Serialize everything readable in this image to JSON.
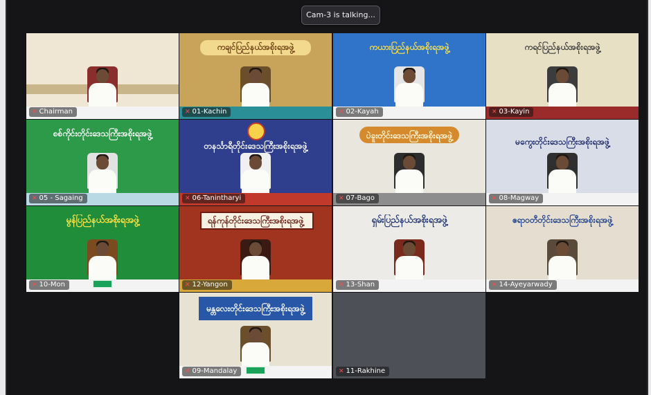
{
  "notification": {
    "text": "Cam-3 is talking..."
  },
  "tiles": [
    {
      "label": "Chairman",
      "wall": "#efe7d4",
      "banner": "",
      "banner_color": "#000000"
    },
    {
      "label": "01-Kachin",
      "wall": "#c8a45a",
      "banner": "ကချင်ပြည်နယ်အစိုးရအဖွဲ့",
      "banner_color": "#6a3d12"
    },
    {
      "label": "02-Kayah",
      "wall": "#2f74c8",
      "banner": "ကယားပြည်နယ်အစိုးရအဖွဲ့",
      "banner_color": "#ffe34d"
    },
    {
      "label": "03-Kayin",
      "wall": "#e8e0c4",
      "banner": "ကရင်ပြည်နယ်အစိုးရအဖွဲ့",
      "banner_color": "#3a3a3a"
    },
    {
      "label": "05 - Sagaing",
      "wall": "#2c9a49",
      "banner": "စစ်ကိုင်းတိုင်းဒေသကြီးအစိုးရအဖွဲ့",
      "banner_color": "#ffffff"
    },
    {
      "label": "06-Tanintharyi",
      "wall": "#2f3f8e",
      "banner": "တနင်္သာရီတိုင်းဒေသကြီးအစိုးရအဖွဲ့",
      "banner_color": "#ffffff"
    },
    {
      "label": "07-Bago",
      "wall": "#e9e6de",
      "banner": "ပဲခူးတိုင်းဒေသကြီးအစိုးရအဖွဲ့",
      "banner_color": "#7a3a10"
    },
    {
      "label": "08-Magway",
      "wall": "#d8dde7",
      "banner": "မကွေးတိုင်းဒေသကြီးအစိုးရအဖွဲ့",
      "banner_color": "#1e2a6a"
    },
    {
      "label": "10-Mon",
      "wall": "#1f8d3a",
      "banner": "မွန်ပြည်နယ်အစိုးရအဖွဲ့",
      "banner_color": "#ffe84a"
    },
    {
      "label": "12-Yangon",
      "wall": "#a0341f",
      "banner": "ရန်ကုန်တိုင်းဒေသကြီးအစိုးရအဖွဲ့",
      "banner_color": "#ffffff"
    },
    {
      "label": "13-Shan",
      "wall": "#ecebe7",
      "banner": "ရှမ်းပြည်နယ်အစိုးရအဖွဲ့",
      "banner_color": "#1f3476"
    },
    {
      "label": "14-Ayeyarwady",
      "wall": "#e4ddd0",
      "banner": "ဧရာဝတီတိုင်းဒေသကြီးအစိုးရအဖွဲ့",
      "banner_color": "#1a3d8f"
    },
    {
      "label": "09-Mandalay",
      "wall": "#e8e2d2",
      "banner": "မန္တလေးတိုင်းဒေသကြီးအစိုးရအဖွဲ့",
      "banner_color": "#ffffff"
    },
    {
      "label": "11-Rakhine",
      "wall": "#4d5157",
      "banner": "",
      "banner_color": "#ffffff"
    }
  ]
}
